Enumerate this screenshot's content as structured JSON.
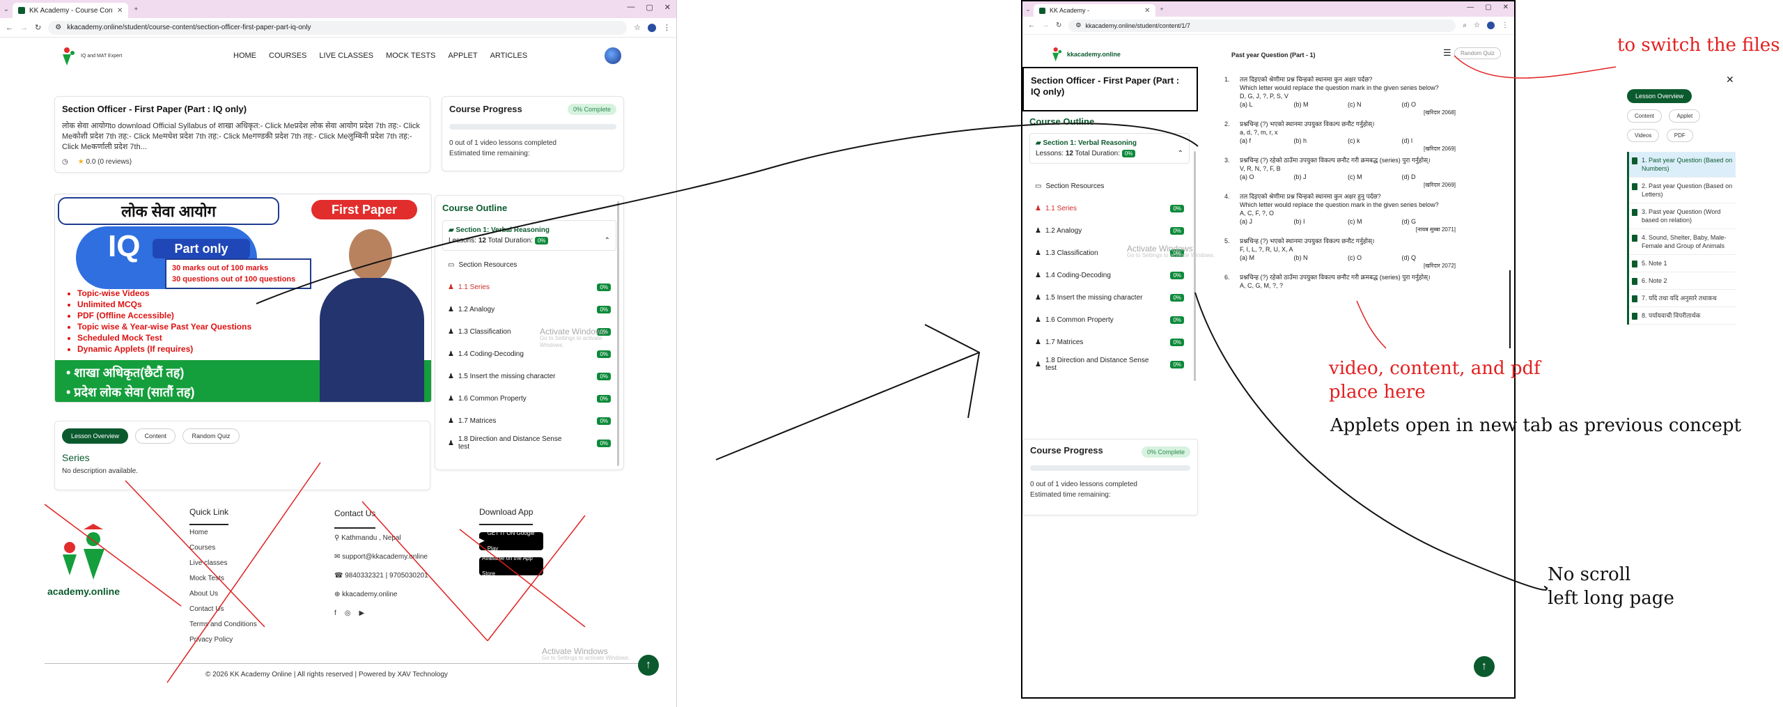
{
  "left_window": {
    "tab_title": "KK Academy - Course Contents",
    "url": "kkacademy.online/student/course-content/section-officer-first-paper-part-iq-only",
    "logo_text": "kkacademy.online",
    "logo_stamp": "IQ and MAT Expert",
    "nav_links": [
      "HOME",
      "COURSES",
      "LIVE CLASSES",
      "MOCK TESTS",
      "APPLET",
      "ARTICLES"
    ],
    "course_title": "Section Officer - First Paper (Part : IQ only)",
    "course_desc": "लोक सेवा आयोगto download Official Syllabus of शाखा अधिकृत:- Click Meप्रदेश लोक सेवा आयोग प्रदेश 7th तह:- Click Meकोशी प्रदेश 7th तह:- Click Meमधेश प्रदेश 7th तह:- Click Meगण्डकी प्रदेश 7th तह:- Click Meलुम्बिनी प्रदेश 7th तह:- Click Meकर्णाली प्रदेश 7th...",
    "rating": "0.0 (0 reviews)",
    "progress_title": "Course Progress",
    "progress_badge": "0% Complete",
    "progress_line1": "0 out of 1 video lessons completed",
    "progress_line2": "Estimated time remaining:",
    "progress_fraction": 0,
    "banner": {
      "headline": "लोक सेवा आयोग",
      "red_pill": "First Paper",
      "iq": "IQ",
      "part_only": "Part only",
      "box_line1": "30 marks out of 100 marks",
      "box_line2": "30 questions out of 100 questions",
      "bullets": [
        "Topic-wise Videos",
        "Unlimited MCQs",
        "PDF (Offline Accessible)",
        "Topic wise & Year-wise Past Year Questions",
        "Scheduled Mock Test",
        "Dynamic Applets (If requires)"
      ],
      "green_line1": "• शाखा अधिकृत(छैटौं तह)",
      "green_line2": "• प्रदेश लोक सेवा (सातौं तह)"
    },
    "outline_title": "Course Outline",
    "section_title": "Section 1: Verbal Reasoning",
    "section_lessons_label": "Lessons:",
    "section_lessons_count": "12",
    "section_duration_label": "Total Duration:",
    "section_duration": "0%",
    "lessons": [
      {
        "name": "Section Resources",
        "pct": ""
      },
      {
        "name": "1.1 Series",
        "pct": "0%"
      },
      {
        "name": "1.2 Analogy",
        "pct": "0%"
      },
      {
        "name": "1.3 Classification",
        "pct": "0%"
      },
      {
        "name": "1.4 Coding-Decoding",
        "pct": "0%"
      },
      {
        "name": "1.5 Insert the missing character",
        "pct": "0%"
      },
      {
        "name": "1.6 Common Property",
        "pct": "0%"
      },
      {
        "name": "1.7 Matrices",
        "pct": "0%"
      },
      {
        "name": "1.8 Direction and Distance Sense test",
        "pct": "0%"
      }
    ],
    "tabs": [
      "Lesson Overview",
      "Content",
      "Random Quiz"
    ],
    "series_title": "Series",
    "series_desc": "No description available.",
    "footer": {
      "brand": "academy.online",
      "quick_link_title": "Quick Link",
      "quick_links": [
        "Home",
        "Courses",
        "Live classes",
        "Mock Tests",
        "About Us",
        "Contact Us",
        "Terms and Conditions",
        "Privacy Policy"
      ],
      "contact_title": "Contact Us",
      "address": "Kathmandu , Nepal",
      "email": "support@kkacademy.online",
      "phones": "9840332321  |  9705030201",
      "website": "kkacademy.online",
      "download_title": "Download App",
      "google_play": "GET IT ON Google Play",
      "app_store": "Available on the App Store",
      "copyright": "© 2026 KK Academy Online | All rights reserved | Powered by XAV Technology"
    },
    "watermark": "Activate Windows",
    "watermark_sub": "Go to Settings to activate Windows."
  },
  "right_window": {
    "tab_title": "KK Academy -",
    "url": "kkacademy.online/student/content/1/7",
    "logo_text": "kkacademy.online",
    "course_title": "Section Officer - First Paper (Part : IQ only)",
    "outline_title": "Course Outline",
    "section_title": "Section 1: Verbal Reasoning",
    "section_lessons_label": "Lessons:",
    "section_lessons_count": "12",
    "section_duration_label": "Total Duration:",
    "section_duration": "0%",
    "lessons": [
      {
        "name": "Section Resources",
        "pct": ""
      },
      {
        "name": "1.1 Series",
        "pct": "0%"
      },
      {
        "name": "1.2 Analogy",
        "pct": "0%"
      },
      {
        "name": "1.3 Classification",
        "pct": "0%"
      },
      {
        "name": "1.4 Coding-Decoding",
        "pct": "0%"
      },
      {
        "name": "1.5 Insert the missing character",
        "pct": "0%"
      },
      {
        "name": "1.6 Common Property",
        "pct": "0%"
      },
      {
        "name": "1.7 Matrices",
        "pct": "0%"
      },
      {
        "name": "1.8 Direction and Distance Sense test",
        "pct": "0%"
      }
    ],
    "content_title": "Past year Question (Part - 1)",
    "random_quiz": "Random Quiz",
    "questions": [
      {
        "n": "1.",
        "np": "तल दिइएको श्रेणीमा प्रश्न चिन्हको स्थानमा कुन अक्षर पर्दछ?",
        "en": "Which letter would replace the question mark in the given series below?",
        "seq": "D, G, J, ?, P, S, V",
        "opts": [
          "(a) L",
          "(b) M",
          "(c) N",
          "(d) O"
        ],
        "yr": "[खरिदार 2068]"
      },
      {
        "n": "2.",
        "np": "प्रश्नचिन्ह (?) भएको स्थानमा उपयुक्त विकल्प छनौट गर्नुहोस्।",
        "en": "",
        "seq": "a, d, ?, m, r, x",
        "opts": [
          "(a) f",
          "(b) h",
          "(c) k",
          "(d) l"
        ],
        "yr": "[खरिदार 2069]"
      },
      {
        "n": "3.",
        "np": "प्रश्नचिन्ह (?) रहेको ठाउँमा उपयुक्त विकल्प छनौट गरी क्रमबद्ध (series) पुरा गर्नुहोस्।",
        "en": "",
        "seq": "V, R, N, ?, F, B",
        "opts": [
          "(a) O",
          "(b) J",
          "(c) M",
          "(d) D"
        ],
        "yr": "[खरिदार 2069]"
      },
      {
        "n": "4.",
        "np": "तल दिइएको श्रेणीमा प्रश्न चिन्हको स्थानमा कुन अक्षर हुनु पर्दछ?",
        "en": "Which letter would replace the question mark in the given series below?",
        "seq": "A, C, F, ?, O",
        "opts": [
          "(a) J",
          "(b) I",
          "(c) M",
          "(d) G"
        ],
        "yr": "[नायब सुब्बा 2071]"
      },
      {
        "n": "5.",
        "np": "प्रश्नचिन्ह (?) भएको स्थानमा उपयुक्त विकल्प छनौट गर्नुहोस्।",
        "en": "",
        "seq": "F, I, L, ?, R, U, X, A",
        "opts": [
          "(a) M",
          "(b) N",
          "(c) O",
          "(d) Q"
        ],
        "yr": "[खरिदार 2072]"
      },
      {
        "n": "6.",
        "np": "प्रश्नचिन्ह (?) रहेको ठाउँमा उपयुक्त विकल्प छनौट गरी क्रमबद्ध (series) पुरा गर्नुहोस्।",
        "en": "",
        "seq": "A, C, G, M, ?, ?",
        "opts": [],
        "yr": ""
      }
    ],
    "progress_title": "Course Progress",
    "progress_badge": "0% Complete",
    "progress_line1": "0 out of 1 video lessons completed",
    "progress_line2": "Estimated time remaining:",
    "watermark": "Activate Windows",
    "watermark_sub": "Go to Settings to activate Windows."
  },
  "side_panel": {
    "lesson_overview": "Lesson Overview",
    "buttons": [
      "Content",
      "Applet",
      "Videos",
      "PDF"
    ],
    "files": [
      "1. Past year Question (Based on Numbers)",
      "2. Past year Question (Based on Letters)",
      "3. Past year Question (Word based on relation)",
      "4. Sound, Shelter, Baby, Male-Female and Group of Animals",
      "5. Note 1",
      "6. Note 2",
      "7. यदि तथा यदि अनुसारे तथाकथ",
      "8. पर्यायवाची विपरीतार्थक"
    ]
  },
  "annotations": {
    "switch_files": "to switch the files",
    "video_place_1": "video, content, and pdf",
    "video_place_2": "place here",
    "applets": "Applets open in new tab as previous concept",
    "no_scroll_1": "No scroll",
    "no_scroll_2": "left long page"
  },
  "colors": {
    "brand_green": "#0b5a2e",
    "accent_red": "#e22020",
    "tab_bar": "#f1dcef"
  }
}
